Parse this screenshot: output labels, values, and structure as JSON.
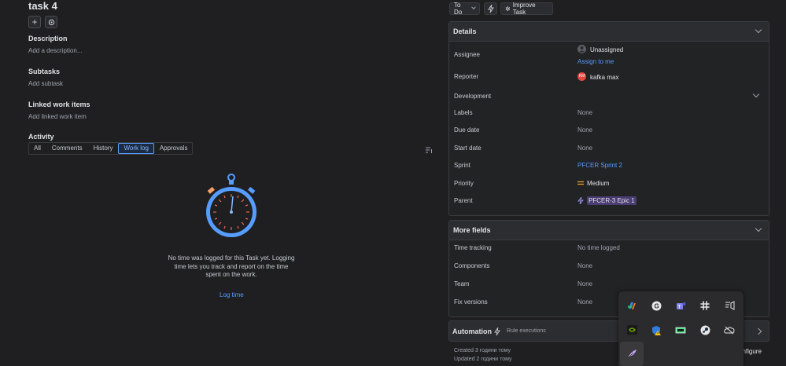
{
  "task": {
    "title": "task 4",
    "description_heading": "Description",
    "description_placeholder": "Add a description...",
    "subtasks_heading": "Subtasks",
    "subtasks_placeholder": "Add subtask",
    "linked_heading": "Linked work items",
    "linked_placeholder": "Add linked work item"
  },
  "activity": {
    "heading": "Activity",
    "tabs": [
      "All",
      "Comments",
      "History",
      "Work log",
      "Approvals"
    ],
    "active_tab": "Work log",
    "empty_line1": "No time was logged for this Task yet. Logging",
    "empty_line2": "time lets you track and report on the time",
    "empty_line3": "spent on the work.",
    "log_time": "Log time"
  },
  "topbar": {
    "status": "To Do",
    "improve": "Improve Task"
  },
  "details": {
    "heading": "Details",
    "assignee_label": "Assignee",
    "assignee_value": "Unassigned",
    "assign_to_me": "Assign to me",
    "reporter_label": "Reporter",
    "reporter_initials": "KM",
    "reporter_value": "kafka max",
    "development_label": "Development",
    "labels_label": "Labels",
    "labels_value": "None",
    "due_label": "Due date",
    "due_value": "None",
    "start_label": "Start date",
    "start_value": "None",
    "sprint_label": "Sprint",
    "sprint_value": "PFCER Sprint 2",
    "priority_label": "Priority",
    "priority_value": "Medium",
    "parent_label": "Parent",
    "parent_value": "PFCER-3 Epic 1"
  },
  "more_fields": {
    "heading": "More fields",
    "time_label": "Time tracking",
    "time_value": "No time logged",
    "components_label": "Components",
    "components_value": "None",
    "team_label": "Team",
    "team_value": "None",
    "fix_label": "Fix versions",
    "fix_value": "None"
  },
  "automation": {
    "heading": "Automation",
    "rule": "Rule executions",
    "configure": "onfigure"
  },
  "meta": {
    "created": "Created 3 години тому",
    "updated": "Updated 2 години тому"
  },
  "colors": {
    "accent": "#579dff",
    "avatar": "#e2483d",
    "priority": "#f5a623",
    "epic": "#9f8fef"
  }
}
